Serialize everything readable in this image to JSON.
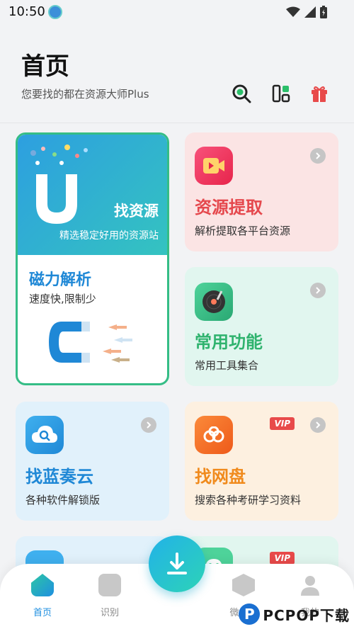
{
  "status_bar": {
    "time": "10:50"
  },
  "header": {
    "title": "首页",
    "subtitle": "您要找的都在资源大师Plus"
  },
  "cards": {
    "find_resource": {
      "title": "找资源",
      "subtitle": "精选稳定好用的资源站"
    },
    "magnet": {
      "title": "磁力解析",
      "desc": "速度快,限制少"
    },
    "extract": {
      "title": "资源提取",
      "desc": "解析提取各平台资源",
      "title_color": "#e5484d"
    },
    "tools": {
      "title": "常用功能",
      "desc": "常用工具集合",
      "title_color": "#2fb36e"
    },
    "lanzou": {
      "title": "找蓝奏云",
      "desc": "各种软件解锁版",
      "title_color": "#1f88d6"
    },
    "netdisk": {
      "title": "找网盘",
      "desc": "搜索各种考研学习资料",
      "vip": "VIP",
      "title_color": "#f08a1c"
    }
  },
  "bottom_row_vip": "VIP",
  "tabbar": {
    "items": [
      {
        "label": "首页",
        "icon": "home-icon",
        "active": true
      },
      {
        "label": "识别",
        "icon": "bag-icon",
        "active": false
      },
      {
        "label": "微应用",
        "icon": "cube-icon",
        "active": false
      },
      {
        "label": "我的",
        "icon": "user-icon",
        "active": false
      }
    ]
  },
  "watermark": {
    "logo": "P",
    "text": "PCPOP下载"
  },
  "colors": {
    "accent": "#1f8fe0",
    "green": "#35bd86",
    "red": "#e5484d",
    "orange": "#f08a1c"
  }
}
